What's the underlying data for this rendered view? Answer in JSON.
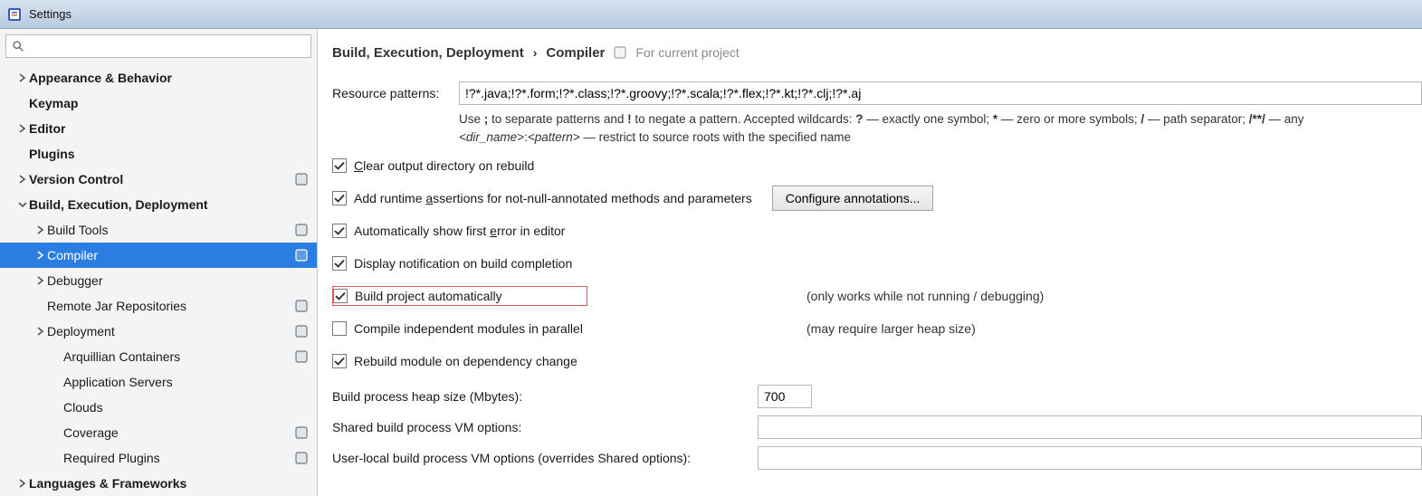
{
  "window": {
    "title": "Settings"
  },
  "search": {
    "value": ""
  },
  "sidebar": {
    "items": [
      {
        "label": "Appearance & Behavior"
      },
      {
        "label": "Keymap"
      },
      {
        "label": "Editor"
      },
      {
        "label": "Plugins"
      },
      {
        "label": "Version Control"
      },
      {
        "label": "Build, Execution, Deployment"
      },
      {
        "label": "Build Tools"
      },
      {
        "label": "Compiler"
      },
      {
        "label": "Debugger"
      },
      {
        "label": "Remote Jar Repositories"
      },
      {
        "label": "Deployment"
      },
      {
        "label": "Arquillian Containers"
      },
      {
        "label": "Application Servers"
      },
      {
        "label": "Clouds"
      },
      {
        "label": "Coverage"
      },
      {
        "label": "Required Plugins"
      },
      {
        "label": "Languages & Frameworks"
      }
    ]
  },
  "breadcrumb": {
    "part1": "Build, Execution, Deployment",
    "sep": "›",
    "part2": "Compiler",
    "scope": "For current project"
  },
  "form": {
    "resource_patterns_label": "Resource patterns:",
    "resource_patterns_value": "!?*.java;!?*.form;!?*.class;!?*.groovy;!?*.scala;!?*.flex;!?*.kt;!?*.clj;!?*.aj",
    "hint_line1_a": "Use ",
    "hint_line1_b_strong": ";",
    "hint_line1_c": " to separate patterns and ",
    "hint_line1_d_strong": "!",
    "hint_line1_e": " to negate a pattern. Accepted wildcards: ",
    "hint_line1_f_strong": "?",
    "hint_line1_g": " — exactly one symbol; ",
    "hint_line1_h_strong": "*",
    "hint_line1_i": " — zero or more symbols; ",
    "hint_line1_j_strong": "/",
    "hint_line1_k": " — path separator; ",
    "hint_line1_l_strong": "/**/",
    "hint_line1_m": " — any",
    "hint_line2_a_italic": "<dir_name>",
    "hint_line2_b": ":",
    "hint_line2_c_italic": "<pattern>",
    "hint_line2_d": " — restrict to source roots with the specified name",
    "clear_output_a": "C",
    "clear_output_b": "lear output directory on rebuild",
    "add_runtime_a": "Add runtime ",
    "add_runtime_b": "a",
    "add_runtime_c": "ssertions for not-null-annotated methods and parameters",
    "configure_annotations": "Configure annotations...",
    "auto_show_error_a": "Automatically show first ",
    "auto_show_error_b": "e",
    "auto_show_error_c": "rror in editor",
    "display_notification": "Display notification on build completion",
    "build_auto": "Build project automatically",
    "build_auto_aside": "(only works while not running / debugging)",
    "compile_parallel": "Compile independent modules in parallel",
    "compile_parallel_aside": "(may require larger heap size)",
    "rebuild_module": "Rebuild module on dependency change",
    "heap_label": "Build process heap size (Mbytes):",
    "heap_value": "700",
    "shared_vm_label": "Shared build process VM options:",
    "shared_vm_value": "",
    "user_vm_label": "User-local build process VM options (overrides Shared options):",
    "user_vm_value": ""
  }
}
